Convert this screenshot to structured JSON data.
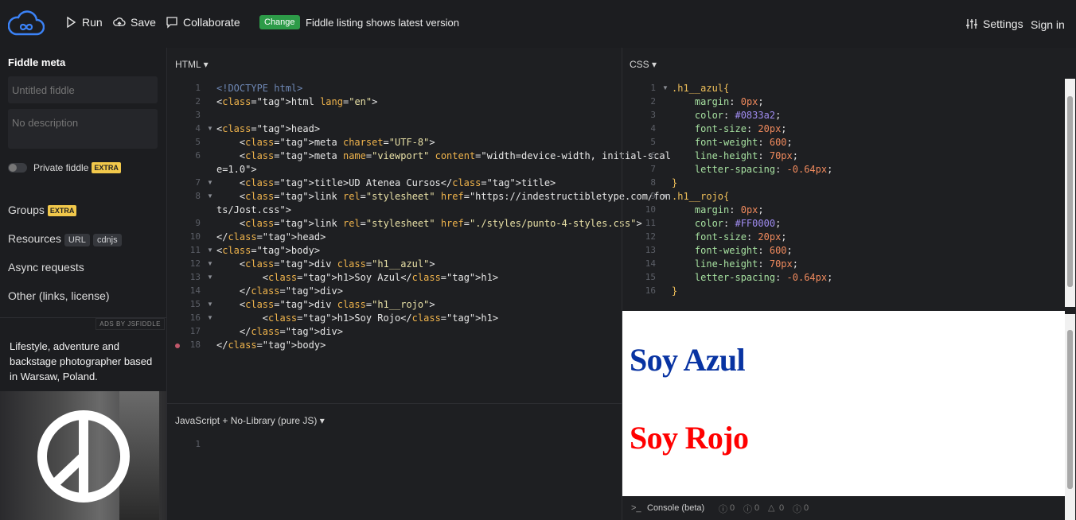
{
  "header": {
    "run_label": "Run",
    "save_label": "Save",
    "collaborate_label": "Collaborate",
    "change_badge": "Change",
    "change_text": "Fiddle listing shows latest version",
    "settings_label": "Settings",
    "signin_label": "Sign in"
  },
  "sidebar": {
    "title": "Fiddle meta",
    "title_placeholder": "Untitled fiddle",
    "description_placeholder": "No description",
    "private_label": "Private fiddle",
    "extra_badge": "EXTRA",
    "groups_label": "Groups",
    "resources_label": "Resources",
    "resources_url": "URL",
    "resources_cdnjs": "cdnjs",
    "async_label": "Async requests",
    "other_label": "Other (links, license)",
    "ads_label": "ADS BY JSFIDDLE",
    "ad_text": "Lifestyle, adventure and backstage photographer based in Warsaw, Poland."
  },
  "panels": {
    "html_label": "HTML",
    "css_label": "CSS",
    "js_label": "JavaScript + No-Library (pure JS)"
  },
  "html_code": [
    {
      "n": "1",
      "text": "<!DOCTYPE html>"
    },
    {
      "n": "2",
      "text": "<html lang=\"en\">"
    },
    {
      "n": "3",
      "text": ""
    },
    {
      "n": "4",
      "text": "<head>"
    },
    {
      "n": "5",
      "text": "    <meta charset=\"UTF-8\">"
    },
    {
      "n": "6",
      "text": "    <meta name=\"viewport\" content=\"width=device-width, initial-scal"
    },
    {
      "n": "",
      "text": "e=1.0\">"
    },
    {
      "n": "7",
      "text": "    <title>UD Atenea Cursos</title>"
    },
    {
      "n": "8",
      "text": "    <link rel=\"stylesheet\" href=\"https://indestructibletype.com/fon"
    },
    {
      "n": "",
      "text": "ts/Jost.css\">"
    },
    {
      "n": "9",
      "text": "    <link rel=\"stylesheet\" href=\"./styles/punto-4-styles.css\">"
    },
    {
      "n": "10",
      "text": "</head>"
    },
    {
      "n": "11",
      "text": "<body>"
    },
    {
      "n": "12",
      "text": "    <div class=\"h1__azul\">"
    },
    {
      "n": "13",
      "text": "        <h1>Soy Azul</h1>"
    },
    {
      "n": "14",
      "text": "    </div>"
    },
    {
      "n": "15",
      "text": "    <div class=\"h1__rojo\">"
    },
    {
      "n": "16",
      "text": "        <h1>Soy Rojo</h1>"
    },
    {
      "n": "17",
      "text": "    </div>"
    },
    {
      "n": "18",
      "text": "</body>"
    }
  ],
  "css_code": [
    {
      "n": "1",
      "text": ".h1__azul{"
    },
    {
      "n": "2",
      "text": "    margin: 0px;"
    },
    {
      "n": "3",
      "text": "    color: #0833a2;"
    },
    {
      "n": "4",
      "text": "    font-size: 20px;"
    },
    {
      "n": "5",
      "text": "    font-weight: 600;"
    },
    {
      "n": "6",
      "text": "    line-height: 70px;"
    },
    {
      "n": "7",
      "text": "    letter-spacing: -0.64px;"
    },
    {
      "n": "8",
      "text": "}"
    },
    {
      "n": "9",
      "text": ".h1__rojo{"
    },
    {
      "n": "10",
      "text": "    margin: 0px;"
    },
    {
      "n": "11",
      "text": "    color: #FF0000;"
    },
    {
      "n": "12",
      "text": "    font-size: 20px;"
    },
    {
      "n": "13",
      "text": "    font-weight: 600;"
    },
    {
      "n": "14",
      "text": "    line-height: 70px;"
    },
    {
      "n": "15",
      "text": "    letter-spacing: -0.64px;"
    },
    {
      "n": "16",
      "text": "}"
    }
  ],
  "js_line": "1",
  "result": {
    "azul": "Soy Azul",
    "rojo": "Soy Rojo"
  },
  "console": {
    "label": "Console (beta)",
    "c1": "0",
    "c2": "0",
    "c3": "0",
    "c4": "0"
  },
  "colors": {
    "azul": "#0833a2",
    "rojo": "#FF0000",
    "change_green": "#2d9b48",
    "extra_yellow": "#f1c84b"
  }
}
